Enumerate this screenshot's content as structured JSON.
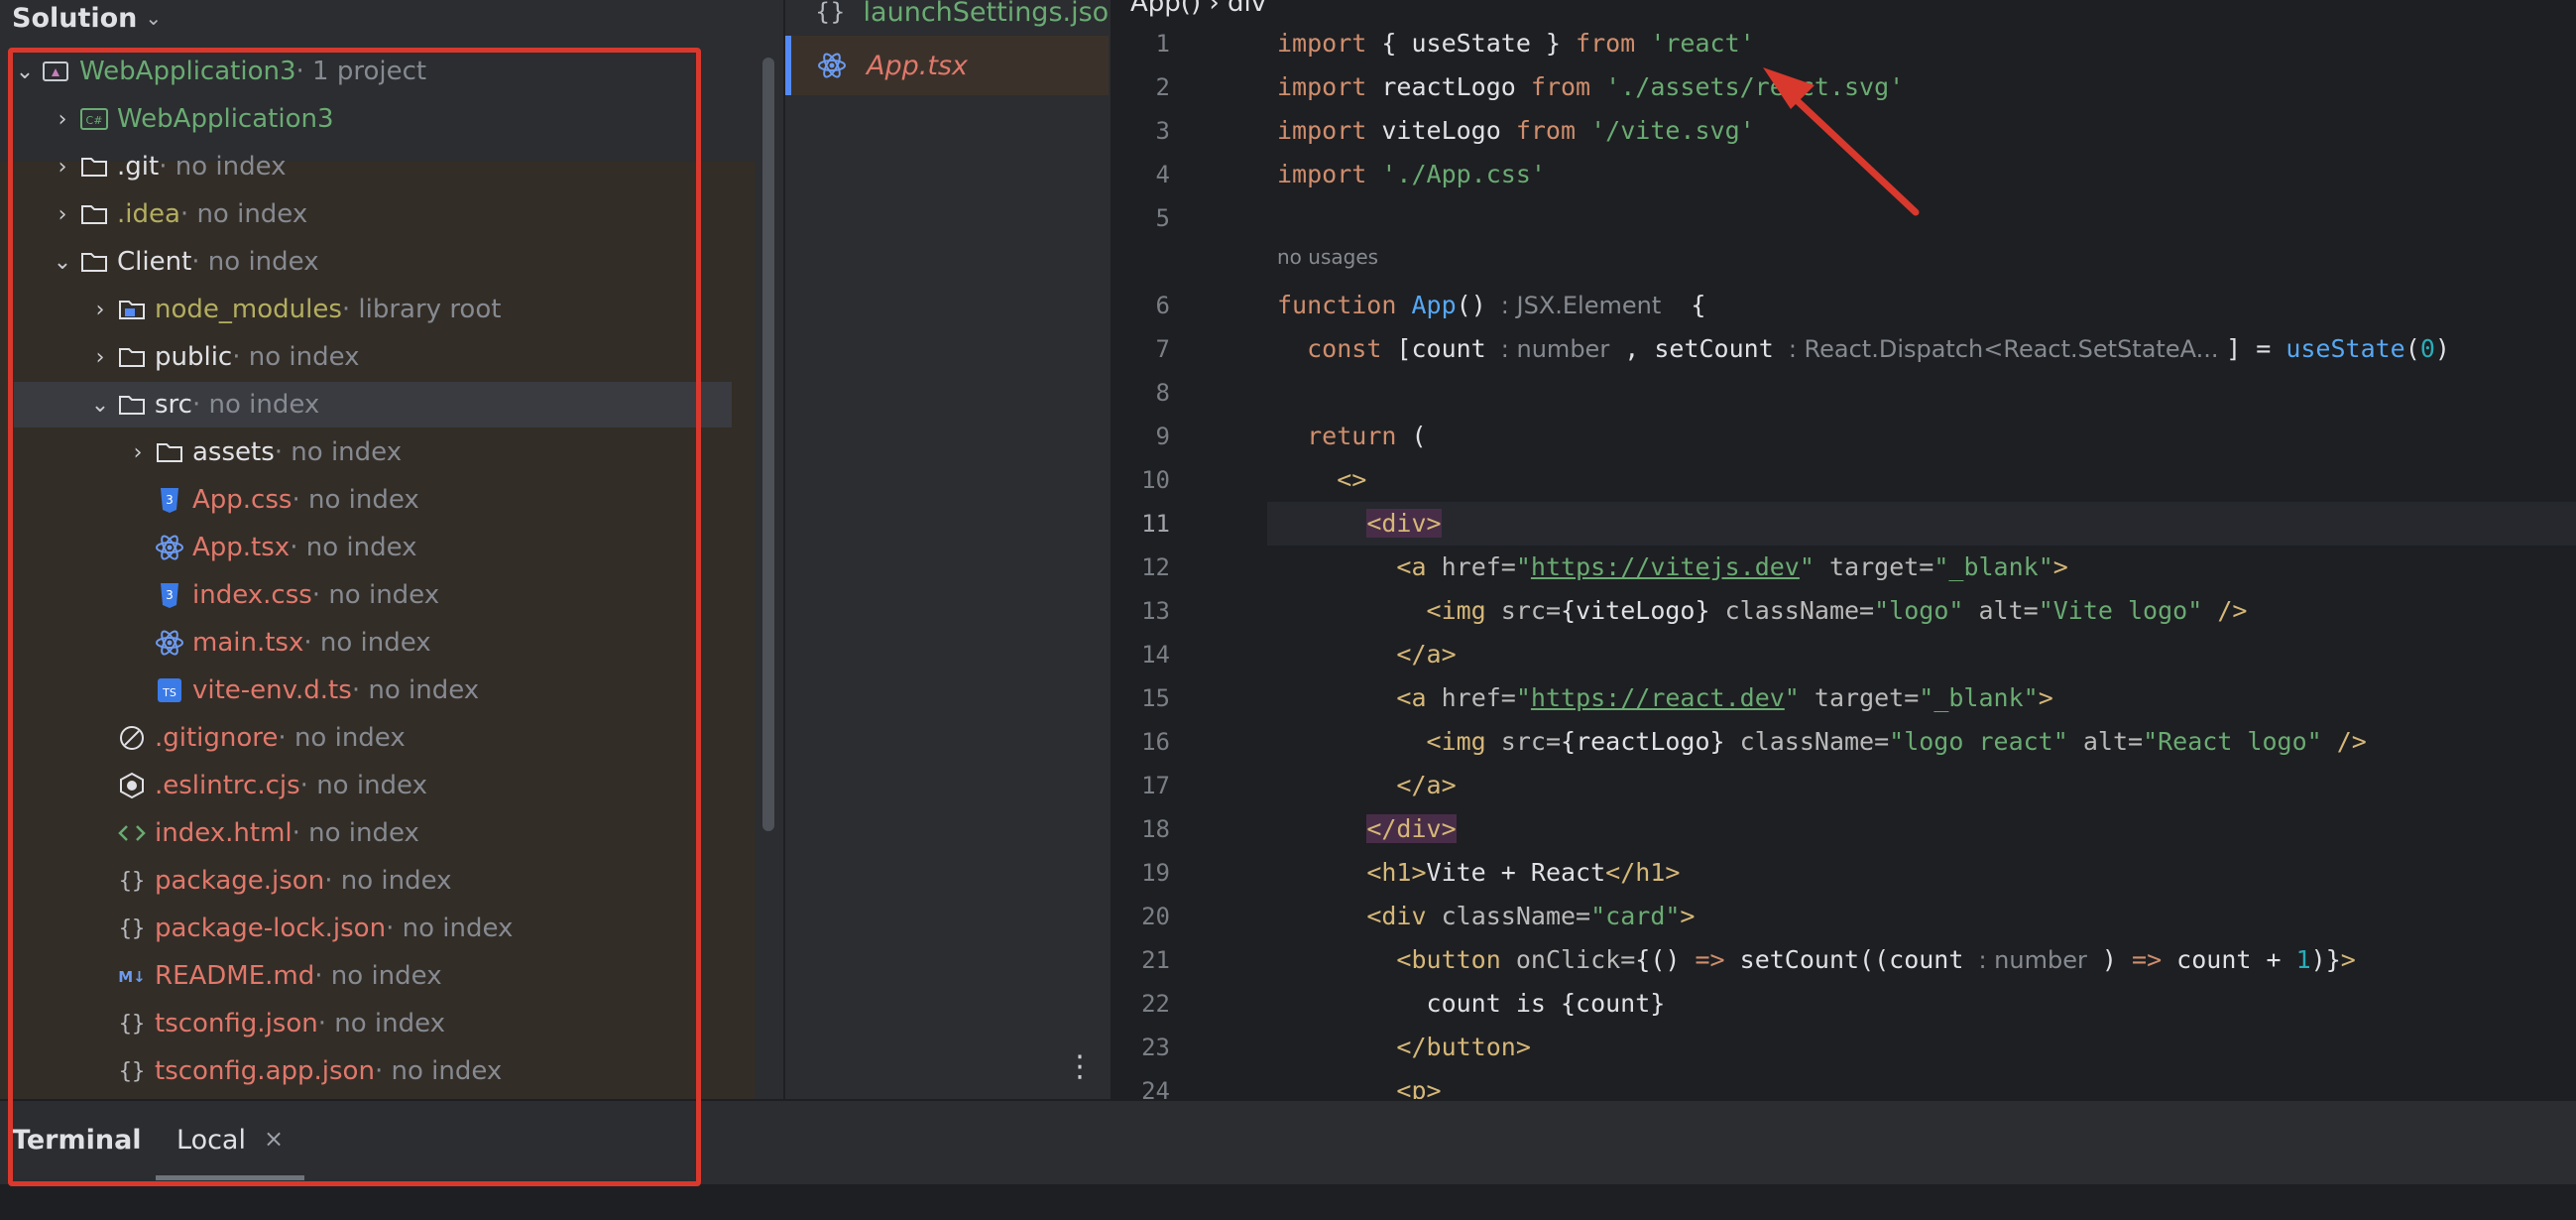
{
  "solution": {
    "title": "Solution",
    "tree": [
      {
        "name": "WebApplication3",
        "hint": " · 1 project",
        "color": "green",
        "icon": "solution-icon",
        "arrow": "v",
        "indent": 0
      },
      {
        "name": "WebApplication3",
        "hint": "",
        "color": "green",
        "icon": "csharp-project-icon",
        "arrow": ">",
        "indent": 1
      },
      {
        "name": ".git",
        "hint": " · no index",
        "color": "white",
        "icon": "folder-icon",
        "arrow": ">",
        "indent": 1
      },
      {
        "name": ".idea",
        "hint": " · no index",
        "color": "olive",
        "icon": "folder-icon",
        "arrow": ">",
        "indent": 1
      },
      {
        "name": "Client",
        "hint": " · no index",
        "color": "white",
        "icon": "folder-icon",
        "arrow": "v",
        "indent": 1
      },
      {
        "name": "node_modules",
        "hint": " · library root",
        "color": "olive",
        "icon": "library-folder-icon",
        "arrow": ">",
        "indent": 2
      },
      {
        "name": "public",
        "hint": " · no index",
        "color": "white",
        "icon": "folder-icon",
        "arrow": ">",
        "indent": 2
      },
      {
        "name": "src",
        "hint": " · no index",
        "color": "white",
        "icon": "folder-icon",
        "arrow": "v",
        "indent": 2,
        "selected": true
      },
      {
        "name": "assets",
        "hint": " · no index",
        "color": "white",
        "icon": "folder-icon",
        "arrow": ">",
        "indent": 3
      },
      {
        "name": "App.css",
        "hint": " · no index",
        "color": "red",
        "icon": "css-file-icon",
        "arrow": "",
        "indent": 3
      },
      {
        "name": "App.tsx",
        "hint": " · no index",
        "color": "red",
        "icon": "react-file-icon",
        "arrow": "",
        "indent": 3
      },
      {
        "name": "index.css",
        "hint": " · no index",
        "color": "red",
        "icon": "css-file-icon",
        "arrow": "",
        "indent": 3
      },
      {
        "name": "main.tsx",
        "hint": " · no index",
        "color": "red",
        "icon": "react-file-icon",
        "arrow": "",
        "indent": 3
      },
      {
        "name": "vite-env.d.ts",
        "hint": " · no index",
        "color": "red",
        "icon": "typescript-file-icon",
        "arrow": "",
        "indent": 3
      },
      {
        "name": ".gitignore",
        "hint": " · no index",
        "color": "red",
        "icon": "ignore-file-icon",
        "arrow": "",
        "indent": 2
      },
      {
        "name": ".eslintrc.cjs",
        "hint": " · no index",
        "color": "red",
        "icon": "eslint-file-icon",
        "arrow": "",
        "indent": 2
      },
      {
        "name": "index.html",
        "hint": " · no index",
        "color": "red",
        "icon": "html-file-icon",
        "arrow": "",
        "indent": 2
      },
      {
        "name": "package.json",
        "hint": " · no index",
        "color": "red",
        "icon": "json-file-icon",
        "arrow": "",
        "indent": 2
      },
      {
        "name": "package-lock.json",
        "hint": " · no index",
        "color": "red",
        "icon": "json-file-icon",
        "arrow": "",
        "indent": 2
      },
      {
        "name": "README.md",
        "hint": " · no index",
        "color": "red",
        "icon": "markdown-file-icon",
        "arrow": "",
        "indent": 2
      },
      {
        "name": "tsconfig.json",
        "hint": " · no index",
        "color": "red",
        "icon": "json-file-icon",
        "arrow": "",
        "indent": 2
      },
      {
        "name": "tsconfig.app.json",
        "hint": " · no index",
        "color": "red",
        "icon": "json-file-icon",
        "arrow": "",
        "indent": 2
      }
    ]
  },
  "tabs": [
    {
      "label": "launchSettings.json",
      "icon": "json-file-icon",
      "active": false
    },
    {
      "label": "App.tsx",
      "icon": "react-file-icon",
      "active": true
    }
  ],
  "editor": {
    "breadcrumb": "App()  ›  div",
    "line_numbers": [
      "1",
      "2",
      "3",
      "4",
      "5",
      "6",
      "7",
      "8",
      "9",
      "10",
      "11",
      "12",
      "13",
      "14",
      "15",
      "16",
      "17",
      "18",
      "19",
      "20",
      "21",
      "22",
      "23",
      "24"
    ],
    "usage_hint": "no usages",
    "current_line": 11
  },
  "terminal": {
    "title": "Terminal",
    "tab": "Local",
    "close": "×"
  },
  "colors": {
    "highlight_border": "#d9382d",
    "accent": "#548af7"
  }
}
